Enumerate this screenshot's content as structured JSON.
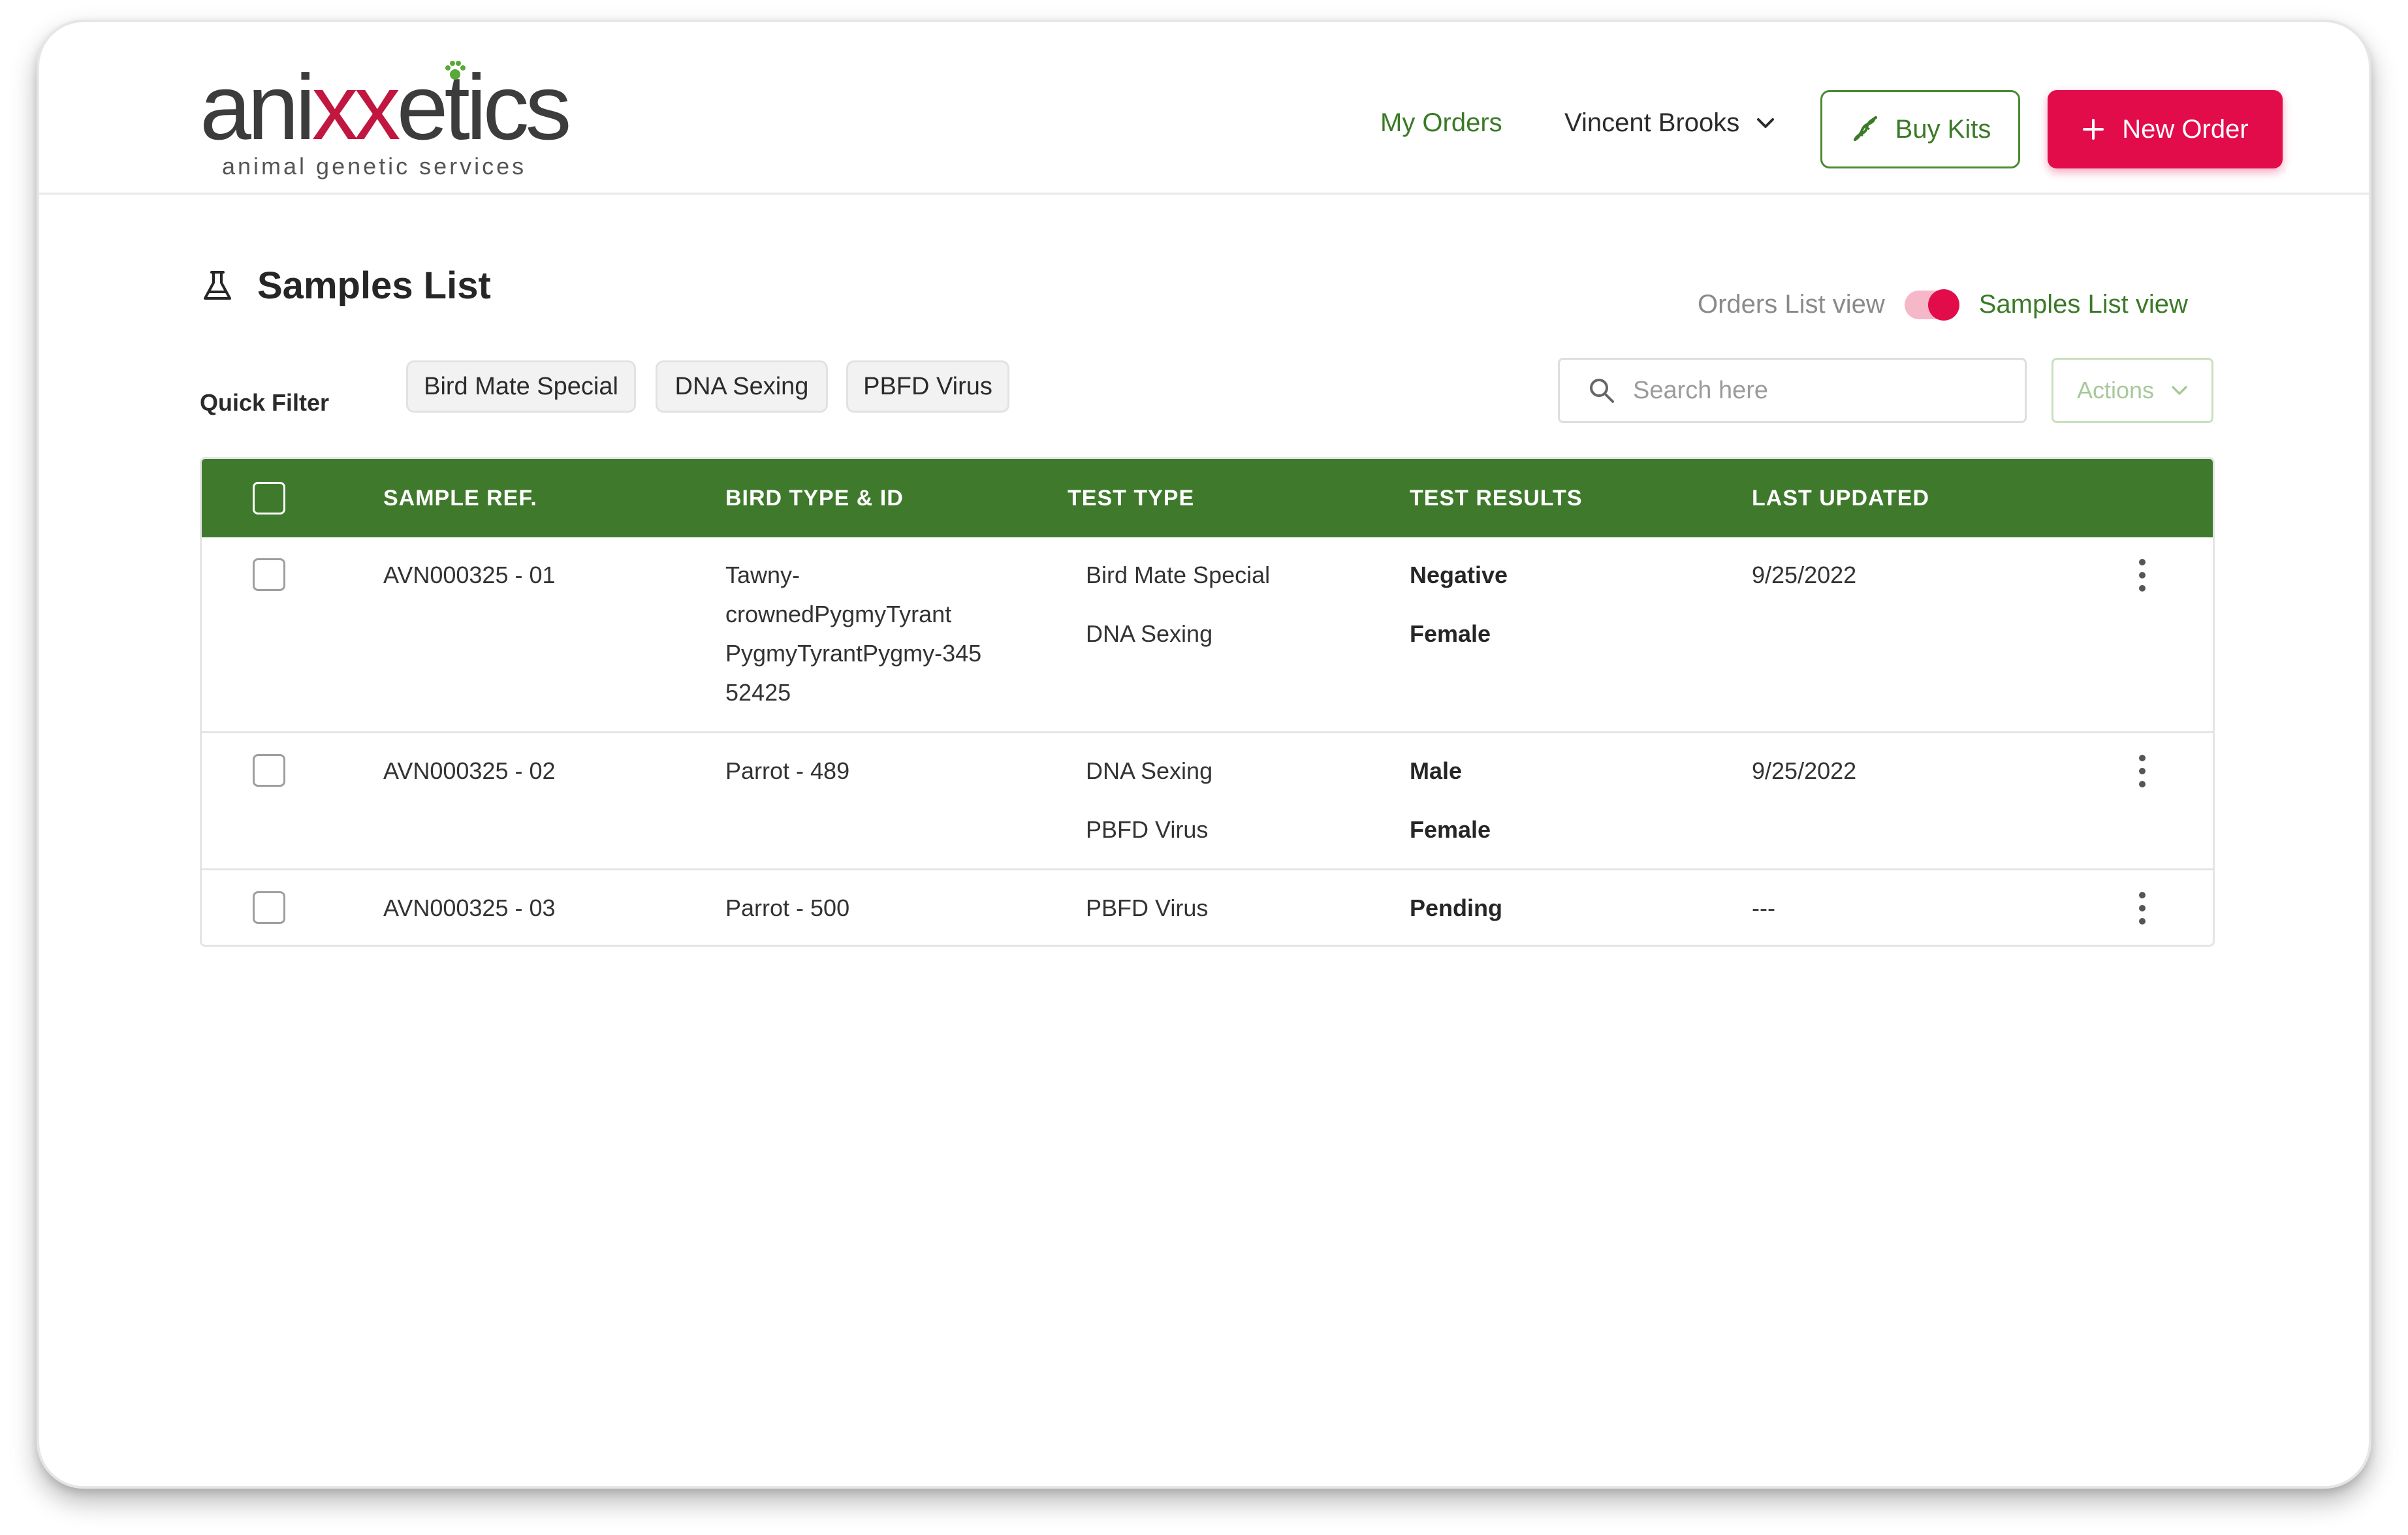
{
  "brand": {
    "logo_prefix": "ani",
    "logo_mid": "xx",
    "logo_suffix": "etics",
    "tagline": "animal genetic services",
    "accent_green": "#3f7a2c",
    "accent_red": "#e20c4a"
  },
  "header": {
    "nav_my_orders": "My Orders",
    "user_name": "Vincent Brooks",
    "buy_kits_label": "Buy Kits",
    "new_order_label": "New Order"
  },
  "page": {
    "title": "Samples List",
    "toggle_off_label": "Orders List view",
    "toggle_on_label": "Samples List view",
    "toggle_state": "on"
  },
  "filters": {
    "label": "Quick Filter",
    "chips": [
      "Bird Mate Special",
      "DNA Sexing",
      "PBFD Virus"
    ],
    "search_placeholder": "Search here",
    "actions_label": "Actions"
  },
  "table": {
    "columns": [
      "SAMPLE REF.",
      "BIRD TYPE & ID",
      "TEST TYPE",
      "TEST RESULTS",
      "LAST UPDATED"
    ],
    "rows": [
      {
        "sample_ref": "AVN000325 - 01",
        "bird_lines": [
          "Tawny-",
          "crownedPygmyTyrant",
          "PygmyTyrantPygmy-345",
          "52425"
        ],
        "tests": [
          {
            "type": "Bird Mate Special",
            "result": "Negative"
          },
          {
            "type": "DNA Sexing",
            "result": "Female"
          }
        ],
        "last_updated": "9/25/2022"
      },
      {
        "sample_ref": "AVN000325 - 02",
        "bird_lines": [
          "Parrot - 489"
        ],
        "tests": [
          {
            "type": "DNA Sexing",
            "result": "Male"
          },
          {
            "type": "PBFD Virus",
            "result": "Female"
          }
        ],
        "last_updated": "9/25/2022"
      },
      {
        "sample_ref": "AVN000325 - 03",
        "bird_lines": [
          "Parrot - 500"
        ],
        "tests": [
          {
            "type": "PBFD Virus",
            "result": "Pending"
          }
        ],
        "last_updated": "---"
      }
    ]
  }
}
